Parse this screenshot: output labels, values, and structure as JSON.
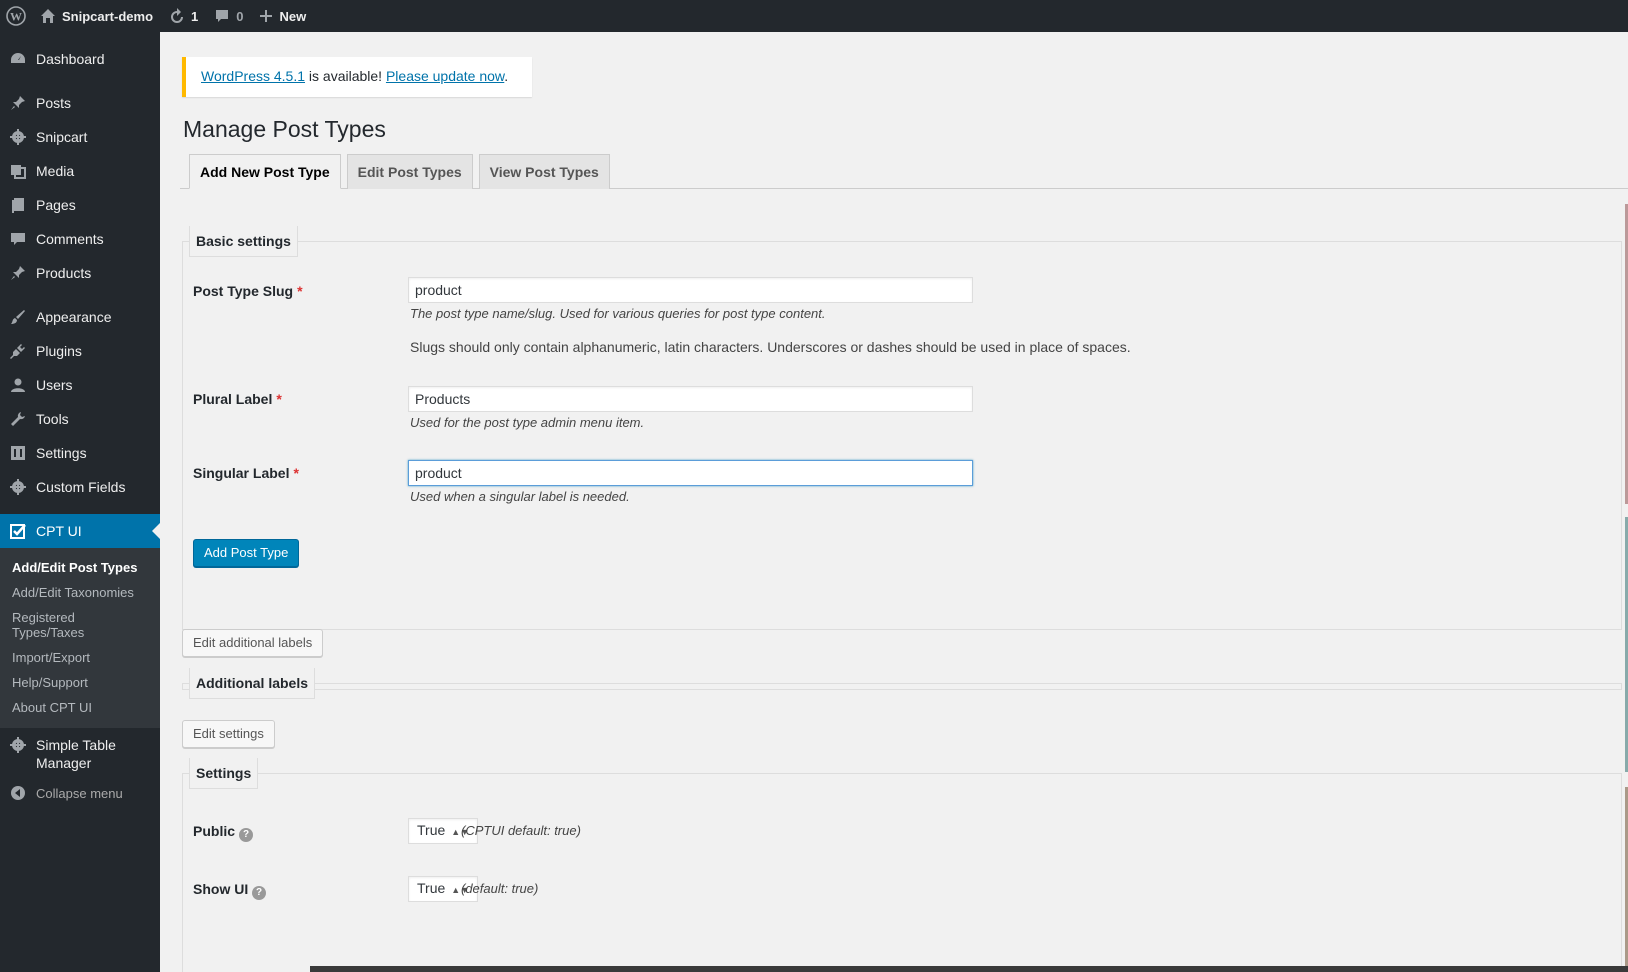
{
  "adminbar": {
    "site_name": "Snipcart-demo",
    "updates_count": "1",
    "comments_count": "0",
    "new_label": "New"
  },
  "sidebar": {
    "items": [
      {
        "label": "Dashboard",
        "icon": "dashboard-icon"
      },
      {
        "label": "Posts",
        "icon": "pin-icon"
      },
      {
        "label": "Snipcart",
        "icon": "gear-icon"
      },
      {
        "label": "Media",
        "icon": "media-icon"
      },
      {
        "label": "Pages",
        "icon": "pages-icon"
      },
      {
        "label": "Comments",
        "icon": "comment-icon"
      },
      {
        "label": "Products",
        "icon": "pin-icon"
      },
      {
        "label": "Appearance",
        "icon": "brush-icon"
      },
      {
        "label": "Plugins",
        "icon": "plugin-icon"
      },
      {
        "label": "Users",
        "icon": "user-icon"
      },
      {
        "label": "Tools",
        "icon": "wrench-icon"
      },
      {
        "label": "Settings",
        "icon": "settings-icon"
      },
      {
        "label": "Custom Fields",
        "icon": "gear-icon"
      },
      {
        "label": "CPT UI",
        "icon": "checkbox-icon"
      }
    ],
    "submenu": [
      "Add/Edit Post Types",
      "Add/Edit Taxonomies",
      "Registered Types/Taxes",
      "Import/Export",
      "Help/Support",
      "About CPT UI"
    ],
    "after": [
      {
        "label": "Simple Table Manager",
        "icon": "gear-icon"
      },
      {
        "label": "Collapse menu",
        "icon": "collapse-icon"
      }
    ]
  },
  "notice": {
    "link1": "WordPress 4.5.1",
    "text": " is available! ",
    "link2": "Please update now",
    "end": "."
  },
  "page": {
    "title": "Manage Post Types",
    "tabs": [
      "Add New Post Type",
      "Edit Post Types",
      "View Post Types"
    ]
  },
  "basic": {
    "legend": "Basic settings",
    "slug_label": "Post Type Slug",
    "slug_value": "product",
    "slug_desc": "The post type name/slug. Used for various queries for post type content.",
    "slug_note": "Slugs should only contain alphanumeric, latin characters. Underscores or dashes should be used in place of spaces.",
    "plural_label": "Plural Label",
    "plural_value": "Products",
    "plural_desc": "Used for the post type admin menu item.",
    "singular_label": "Singular Label",
    "singular_value": "product",
    "singular_desc": "Used when a singular label is needed.",
    "required_mark": "*",
    "submit_label": "Add Post Type"
  },
  "additional": {
    "button_label": "Edit additional labels",
    "legend": "Additional labels"
  },
  "settings": {
    "button_label": "Edit settings",
    "legend": "Settings",
    "public_label": "Public",
    "public_value": "True",
    "public_note": "(CPTUI default: true)",
    "showui_label": "Show UI",
    "showui_value": "True",
    "showui_note": "(default: true)",
    "help_glyph": "?"
  }
}
